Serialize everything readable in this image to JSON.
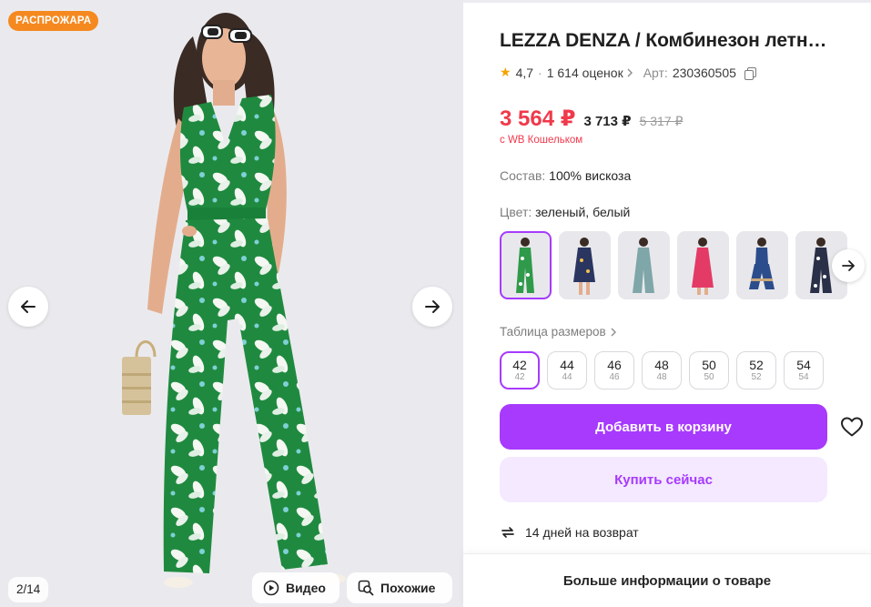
{
  "gallery": {
    "badge": "РАСПРОЖАРА",
    "counter": "2/14",
    "video_label": "Видео",
    "similar_label": "Похожие"
  },
  "product": {
    "title": "LEZZA DENZA / Комбинезон летн…",
    "rating": "4,7",
    "reviews": "1 614 оценок",
    "article_label": "Арт:",
    "article": "230360505",
    "price_main": "3 564 ₽",
    "price_base": "3 713 ₽",
    "price_old": "5 317 ₽",
    "wallet_note": "с WB Кошельком",
    "composition_label": "Состав:",
    "composition": "100% вискоза",
    "color_label": "Цвет:",
    "color": "зеленый, белый",
    "size_table_label": "Таблица размеров",
    "sizes": [
      {
        "main": "42",
        "sub": "42"
      },
      {
        "main": "44",
        "sub": "44"
      },
      {
        "main": "46",
        "sub": "46"
      },
      {
        "main": "48",
        "sub": "48"
      },
      {
        "main": "50",
        "sub": "50"
      },
      {
        "main": "52",
        "sub": "52"
      },
      {
        "main": "54",
        "sub": "54"
      }
    ],
    "selected_size": "42",
    "swatch_colors": [
      "#2f9a4a",
      "#2a3560",
      "#7fa6a8",
      "#e33b66",
      "#2c4d8c",
      "#2a3048"
    ],
    "add_to_cart": "Добавить в корзину",
    "buy_now": "Купить сейчас",
    "returns": "14 дней на возврат",
    "more_info": "Больше информации о товаре"
  },
  "colors": {
    "accent": "#a73afd",
    "accent_light": "#f4e9ff",
    "price_red": "#f0394b",
    "sale_orange": "#f5891f",
    "star": "#f5a300"
  },
  "icons": [
    "arrow-left-icon",
    "arrow-right-icon",
    "play-icon",
    "search-similar-icon",
    "star-icon",
    "copy-icon",
    "chevron-right-icon",
    "heart-icon",
    "return-icon"
  ]
}
